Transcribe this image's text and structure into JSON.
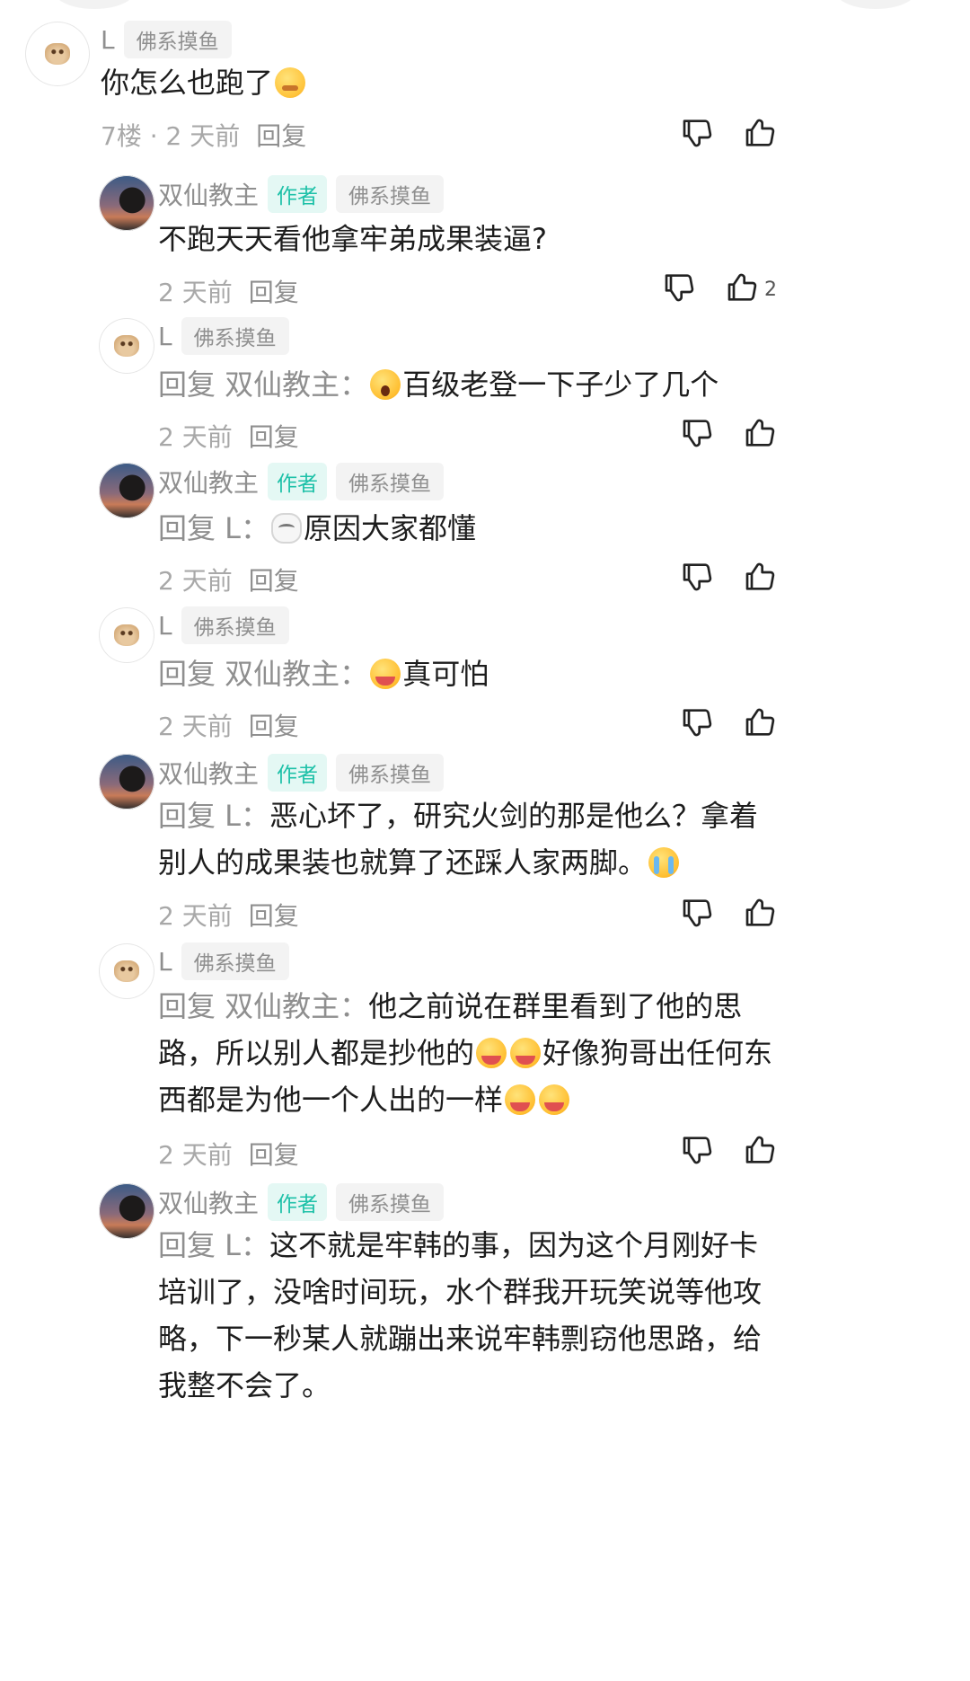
{
  "comments": [
    {
      "user": "L",
      "tag": "佛系摸鱼",
      "text": "你怎么也跑了",
      "floor": "7楼 · 2 天前",
      "reply_label": "回复"
    },
    {
      "user": "双仙教主",
      "badge": "作者",
      "tag": "佛系摸鱼",
      "text": "不跑天天看他拿牢弟成果装逼?",
      "time": "2 天前",
      "reply_label": "回复",
      "likes": "2"
    },
    {
      "user": "L",
      "tag": "佛系摸鱼",
      "reply_prefix": "回复 双仙教主：",
      "text": "百级老登一下子少了几个",
      "time": "2 天前",
      "reply_label": "回复"
    },
    {
      "user": "双仙教主",
      "badge": "作者",
      "tag": "佛系摸鱼",
      "reply_prefix": "回复 L：",
      "text": "原因大家都懂",
      "time": "2 天前",
      "reply_label": "回复"
    },
    {
      "user": "L",
      "tag": "佛系摸鱼",
      "reply_prefix": "回复 双仙教主：",
      "text": "真可怕",
      "time": "2 天前",
      "reply_label": "回复"
    },
    {
      "user": "双仙教主",
      "badge": "作者",
      "tag": "佛系摸鱼",
      "reply_prefix": "回复 L：",
      "text_line1": "恶心坏了，研究火剑的那是他么？拿着",
      "text_line2": "别人的成果装也就算了还踩人家两脚。",
      "time": "2 天前",
      "reply_label": "回复"
    },
    {
      "user": "L",
      "tag": "佛系摸鱼",
      "reply_prefix": "回复 双仙教主：",
      "text_line1": "他之前说在群里看到了他的思",
      "text_line2a": "路，所以别人都是抄他的",
      "text_line2b": "好像狗哥出任何东",
      "text_line3": "西都是为他一个人出的一样",
      "time": "2 天前",
      "reply_label": "回复"
    },
    {
      "user": "双仙教主",
      "badge": "作者",
      "tag": "佛系摸鱼",
      "reply_prefix": "回复 L：",
      "text_line1": "这不就是牢韩的事，因为这个月刚好卡",
      "text_line2": "培训了，没啥时间玩，水个群我开玩笑说等他攻",
      "text_line3": "略，下一秒某人就蹦出来说牢韩剽窃他思路，给",
      "text_line4": "我整不会了。"
    }
  ]
}
